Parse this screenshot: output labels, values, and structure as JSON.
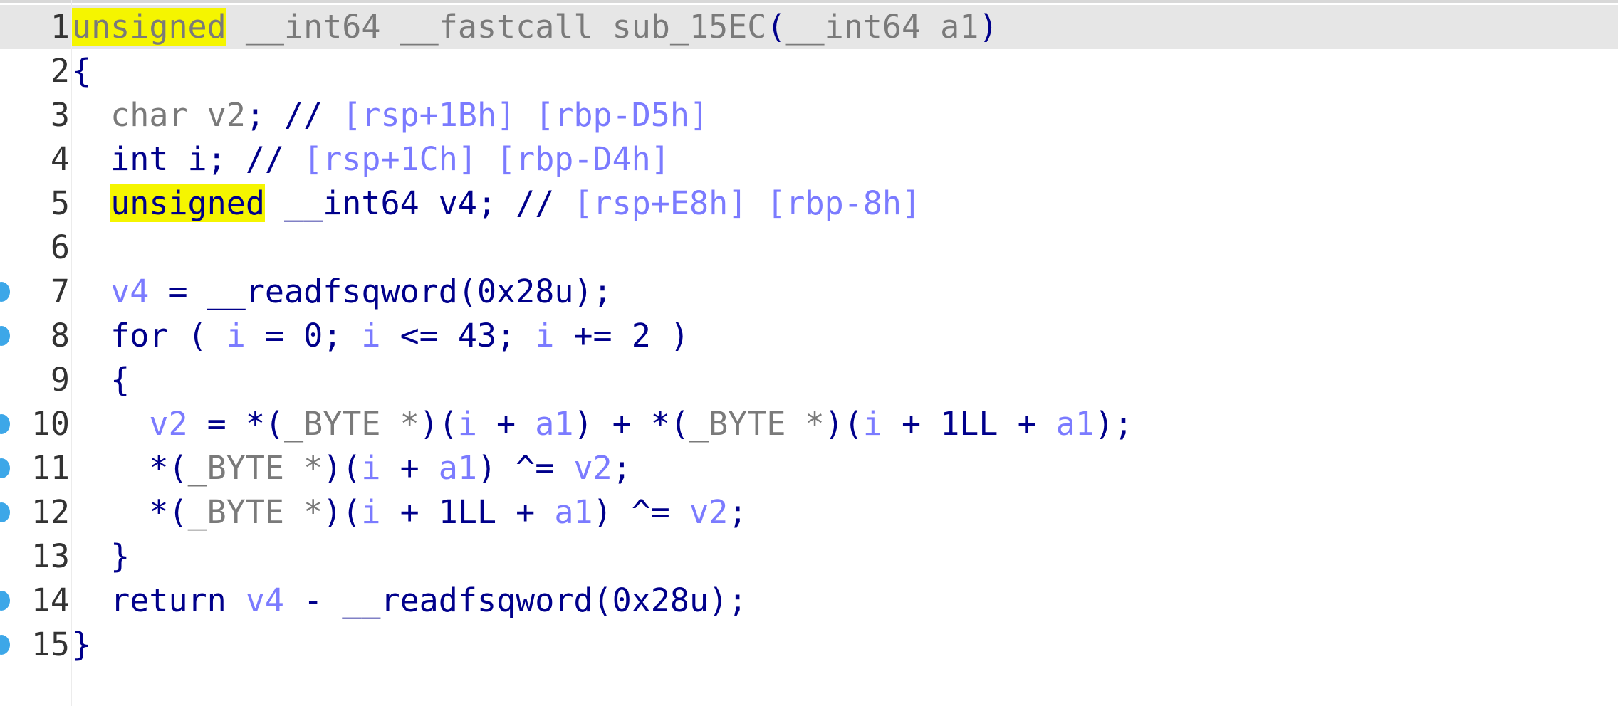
{
  "editor": {
    "colors": {
      "background": "#ffffff",
      "current_line": "#e6e6e6",
      "highlight": "#f5f500",
      "breakpoint": "#3da7e8",
      "keyword_gray": "#7a7a7a",
      "identifier_navy": "#00008b",
      "variable_blue": "#7b7bff"
    },
    "lines": [
      {
        "n": "1",
        "bp": false,
        "current": true,
        "tokens": [
          {
            "t": "unsigned",
            "c": "kw2 hl"
          },
          {
            "t": " __int64 __fastcall sub_15EC",
            "c": "kw2"
          },
          {
            "t": "(",
            "c": "p"
          },
          {
            "t": "__int64 a1",
            "c": "kw2"
          },
          {
            "t": ")",
            "c": "p"
          }
        ]
      },
      {
        "n": "2",
        "bp": false,
        "current": false,
        "tokens": [
          {
            "t": "{",
            "c": "p"
          }
        ]
      },
      {
        "n": "3",
        "bp": false,
        "current": false,
        "tokens": [
          {
            "t": "  char v2",
            "c": "kw2"
          },
          {
            "t": ";",
            "c": "p"
          },
          {
            "t": " // ",
            "c": "p"
          },
          {
            "t": "[rsp+1Bh] [rbp-D5h]",
            "c": "cmt"
          }
        ]
      },
      {
        "n": "4",
        "bp": false,
        "current": false,
        "tokens": [
          {
            "t": "  int i; // ",
            "c": "id"
          },
          {
            "t": "[rsp+1Ch] [rbp-D4h]",
            "c": "cmt"
          }
        ]
      },
      {
        "n": "5",
        "bp": false,
        "current": false,
        "tokens": [
          {
            "t": "  ",
            "c": "id"
          },
          {
            "t": "unsigned",
            "c": "id hl"
          },
          {
            "t": " __int64 v4; // ",
            "c": "id"
          },
          {
            "t": "[rsp+E8h] [rbp-8h]",
            "c": "cmt"
          }
        ]
      },
      {
        "n": "6",
        "bp": false,
        "current": false,
        "tokens": []
      },
      {
        "n": "7",
        "bp": true,
        "current": false,
        "tokens": [
          {
            "t": "  ",
            "c": "id"
          },
          {
            "t": "v4",
            "c": "var"
          },
          {
            "t": " = __readfsqword(0x28u);",
            "c": "id"
          }
        ]
      },
      {
        "n": "8",
        "bp": true,
        "current": false,
        "tokens": [
          {
            "t": "  for ( ",
            "c": "id"
          },
          {
            "t": "i",
            "c": "var"
          },
          {
            "t": " = 0; ",
            "c": "id"
          },
          {
            "t": "i",
            "c": "var"
          },
          {
            "t": " <= 43; ",
            "c": "id"
          },
          {
            "t": "i",
            "c": "var"
          },
          {
            "t": " += 2 )",
            "c": "id"
          }
        ]
      },
      {
        "n": "9",
        "bp": false,
        "current": false,
        "tokens": [
          {
            "t": "  {",
            "c": "id"
          }
        ]
      },
      {
        "n": "10",
        "bp": true,
        "current": false,
        "tokens": [
          {
            "t": "    ",
            "c": "id"
          },
          {
            "t": "v2",
            "c": "var"
          },
          {
            "t": " = *(",
            "c": "id"
          },
          {
            "t": "_BYTE *",
            "c": "kw2"
          },
          {
            "t": ")(",
            "c": "id"
          },
          {
            "t": "i",
            "c": "var"
          },
          {
            "t": " + ",
            "c": "id"
          },
          {
            "t": "a1",
            "c": "var"
          },
          {
            "t": ") + *(",
            "c": "id"
          },
          {
            "t": "_BYTE *",
            "c": "kw2"
          },
          {
            "t": ")(",
            "c": "id"
          },
          {
            "t": "i",
            "c": "var"
          },
          {
            "t": " + 1LL + ",
            "c": "id"
          },
          {
            "t": "a1",
            "c": "var"
          },
          {
            "t": ");",
            "c": "id"
          }
        ]
      },
      {
        "n": "11",
        "bp": true,
        "current": false,
        "tokens": [
          {
            "t": "    *(",
            "c": "id"
          },
          {
            "t": "_BYTE *",
            "c": "kw2"
          },
          {
            "t": ")(",
            "c": "id"
          },
          {
            "t": "i",
            "c": "var"
          },
          {
            "t": " + ",
            "c": "id"
          },
          {
            "t": "a1",
            "c": "var"
          },
          {
            "t": ") ^= ",
            "c": "id"
          },
          {
            "t": "v2",
            "c": "var"
          },
          {
            "t": ";",
            "c": "id"
          }
        ]
      },
      {
        "n": "12",
        "bp": true,
        "current": false,
        "tokens": [
          {
            "t": "    *(",
            "c": "id"
          },
          {
            "t": "_BYTE *",
            "c": "kw2"
          },
          {
            "t": ")(",
            "c": "id"
          },
          {
            "t": "i",
            "c": "var"
          },
          {
            "t": " + 1LL + ",
            "c": "id"
          },
          {
            "t": "a1",
            "c": "var"
          },
          {
            "t": ") ^= ",
            "c": "id"
          },
          {
            "t": "v2",
            "c": "var"
          },
          {
            "t": ";",
            "c": "id"
          }
        ]
      },
      {
        "n": "13",
        "bp": false,
        "current": false,
        "tokens": [
          {
            "t": "  }",
            "c": "id"
          }
        ]
      },
      {
        "n": "14",
        "bp": true,
        "current": false,
        "tokens": [
          {
            "t": "  return ",
            "c": "id"
          },
          {
            "t": "v4",
            "c": "var"
          },
          {
            "t": " - __readfsqword(0x28u);",
            "c": "id"
          }
        ]
      },
      {
        "n": "15",
        "bp": true,
        "current": false,
        "tokens": [
          {
            "t": "}",
            "c": "id"
          }
        ]
      }
    ]
  }
}
